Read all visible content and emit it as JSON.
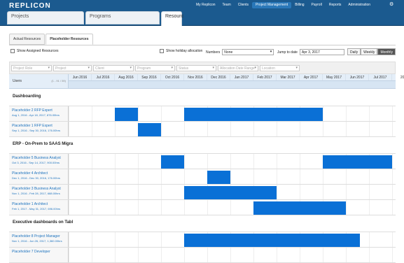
{
  "app": {
    "logo": "REPLICON"
  },
  "nav": [
    {
      "label": "My Replicon",
      "active": false
    },
    {
      "label": "Team",
      "active": false
    },
    {
      "label": "Clients",
      "active": false
    },
    {
      "label": "Project Management",
      "active": true
    },
    {
      "label": "Billing",
      "active": false
    },
    {
      "label": "Payroll",
      "active": false
    },
    {
      "label": "Reports",
      "active": false
    },
    {
      "label": "Administration",
      "active": false
    }
  ],
  "main_tabs": {
    "projects": "Projects",
    "programs": "Programs",
    "resources": "Resourc"
  },
  "sub_tabs": {
    "actual": "Actual Resources",
    "placeholder": "Placeholder Resources"
  },
  "controls": {
    "show_assigned": "Show Assigned Resources",
    "show_holiday": "Show holiday allocation",
    "numbers_label": "Numbers",
    "numbers_value": "None",
    "jump_label": "Jump to date",
    "jump_value": "Apr 3, 2017",
    "views": [
      "Daily",
      "Weekly",
      "Monthly"
    ],
    "active_view": "Monthly"
  },
  "filters": [
    "Project Role",
    "Project",
    "Client",
    "Program",
    "Status",
    "Allocation Date Range",
    "Location"
  ],
  "grid": {
    "users_label": "Users",
    "pager": "(1 - 91 / 59)",
    "months": [
      "Jun 2016",
      "Jul 2016",
      "Aug 2016",
      "Sep 2016",
      "Oct 2016",
      "Nov 2016",
      "Dec 2016",
      "Jan 2017",
      "Feb 2017",
      "Mar 2017",
      "Apr 2017",
      "May 2017",
      "Jun 2017",
      "Jul 2017",
      "201"
    ]
  },
  "rows": [
    {
      "kind": "project",
      "title": "Dashboarding"
    },
    {
      "kind": "resource",
      "name": "Placeholder 2 RFP Expert",
      "dates": "Aug 1, 2016 - Apr 18, 2017, 876.00hrs",
      "bars": [
        [
          2,
          3
        ],
        [
          5,
          10
        ],
        [
          10,
          11
        ]
      ]
    },
    {
      "kind": "resource",
      "name": "Placeholder 1 RFP Expert",
      "dates": "Sep 1, 2016 - Sep 30, 2016, 176.00hrs",
      "bars": [
        [
          3,
          4
        ]
      ]
    },
    {
      "kind": "project",
      "title": "ERP - On-Prem to SAAS Migra"
    },
    {
      "kind": "resource",
      "name": "Placeholder 5 Business Analyst",
      "dates": "Oct 3, 2016 - Sep 14, 2017, 900.00hrs",
      "bars": [
        [
          4,
          5
        ],
        [
          11,
          14
        ]
      ]
    },
    {
      "kind": "resource",
      "name": "Placeholder 4 Architect",
      "dates": "Dec 1, 2016 - Dec 30, 2016, 176.00hrs",
      "bars": [
        [
          6,
          7
        ]
      ]
    },
    {
      "kind": "resource",
      "name": "Placeholder 3 Business Analyst",
      "dates": "Nov 1, 2016 - Feb 28, 2017, 688.00hrs",
      "bars": [
        [
          5,
          9
        ]
      ]
    },
    {
      "kind": "resource",
      "name": "Placeholder 1 Architect",
      "dates": "Feb 1, 2017 - May 31, 2017, 696.00hrs",
      "bars": [
        [
          8,
          12
        ]
      ]
    },
    {
      "kind": "project",
      "title": "Executive dashboards on Tabl"
    },
    {
      "kind": "resource",
      "name": "Placeholder 8 Project Manager",
      "dates": "Nov 1, 2016 - Jun 26, 2017, 1,360.00hrs",
      "bars": [
        [
          5,
          12.6
        ]
      ]
    },
    {
      "kind": "resource",
      "name": "Placeholder 7 Developer",
      "dates": "",
      "bars": []
    }
  ],
  "colors": {
    "topbar": "#1b5a8f",
    "active_nav": "#2a78b9",
    "bar": "#0a70d6",
    "header": "#e4eef8"
  }
}
